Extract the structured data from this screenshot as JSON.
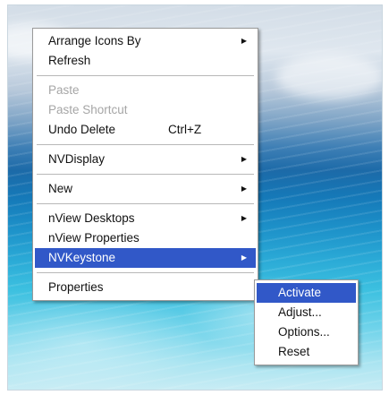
{
  "context_menu": {
    "items": [
      {
        "label": "Arrange Icons By",
        "arrow": "▶"
      },
      {
        "label": "Refresh"
      },
      {
        "label": "Paste"
      },
      {
        "label": "Paste Shortcut"
      },
      {
        "label": "Undo Delete",
        "shortcut": "Ctrl+Z"
      },
      {
        "label": "NVDisplay",
        "arrow": "▶"
      },
      {
        "label": "New",
        "arrow": "▶"
      },
      {
        "label": "nView Desktops",
        "arrow": "▶"
      },
      {
        "label": "nView Properties"
      },
      {
        "label": "NVKeystone",
        "arrow": "▶"
      },
      {
        "label": "Properties"
      }
    ]
  },
  "submenu": {
    "items": [
      {
        "label": "Activate"
      },
      {
        "label": "Adjust..."
      },
      {
        "label": "Options..."
      },
      {
        "label": "Reset"
      }
    ]
  },
  "colors": {
    "highlight": "#3158c8",
    "disabled_text": "#a6a6a6"
  }
}
